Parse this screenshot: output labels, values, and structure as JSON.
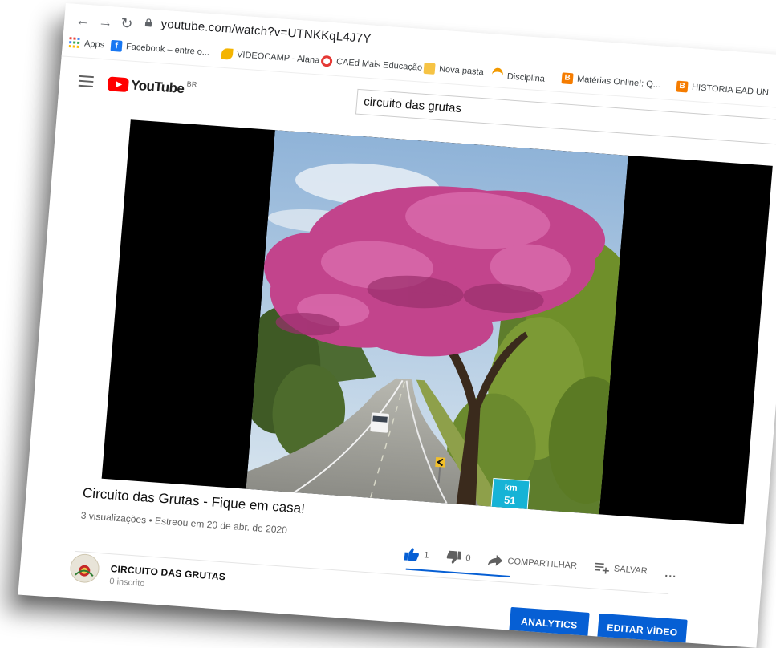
{
  "browser": {
    "url": "youtube.com/watch?v=UTNKKqL4J7Y",
    "bookmarks": [
      {
        "label": "Apps",
        "color": "#e8453c"
      },
      {
        "label": "Facebook – entre o...",
        "color": "#1877f2"
      },
      {
        "label": "VIDEOCAMP - Alana",
        "color": "#f4b400"
      },
      {
        "label": "CAEd Mais Educação",
        "color": "#e53935"
      },
      {
        "label": "Nova pasta",
        "color": "#f6c344"
      },
      {
        "label": "Disciplina",
        "color": "#f29900"
      },
      {
        "label": "Matérias Online!: Q...",
        "color": "#f57c00"
      },
      {
        "label": "HISTORIA EAD UN",
        "color": "#f57c00"
      }
    ]
  },
  "youtube": {
    "logo_word": "YouTube",
    "region": "BR",
    "search_value": "circuito das grutas"
  },
  "video": {
    "title": "Circuito das Grutas - Fique em casa!",
    "meta": "3 visualizações • Estreou em 20 de abr. de 2020",
    "sign_line1": "km",
    "sign_line2": "51",
    "likes": "1",
    "dislikes": "0",
    "share_label": "COMPARTILHAR",
    "save_label": "SALVAR",
    "more_label": "...",
    "like_ratio": 1.0
  },
  "channel": {
    "name": "CIRCUITO DAS GRUTAS",
    "subscribers": "0 inscrito"
  },
  "buttons": {
    "analytics": "ANALYTICS",
    "edit": "EDITAR VÍDEO"
  },
  "colors": {
    "accent": "#065fd4",
    "youtube_red": "#ff0000",
    "blossom": "#c2448c"
  }
}
